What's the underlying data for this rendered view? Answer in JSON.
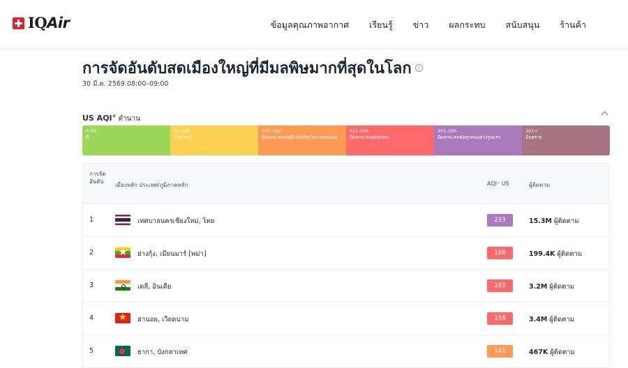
{
  "header": {
    "logo": {
      "prefix": "IQ",
      "suffix": "Air"
    },
    "nav": [
      {
        "label": "ข้อมูลคุณภาพอากาศ"
      },
      {
        "label": "เรียนรู้"
      },
      {
        "label": "ข่าว"
      },
      {
        "label": "ผลกระทบ"
      },
      {
        "label": "สนับสนุน"
      },
      {
        "label": "ร้านค้า"
      }
    ]
  },
  "page": {
    "title": "การจัดอันดับสดเมืองใหญ่ที่มีมลพิษมากที่สุดในโลก",
    "info_icon": "i",
    "timestamp": "30 มี.ค. 2569 08:00–09:00"
  },
  "legend": {
    "title": "US AQI",
    "title_sup": "+",
    "title_sub": "ตำนาน",
    "segments": [
      {
        "range": "0-50",
        "desc": "ดี",
        "color": "#9bd85a"
      },
      {
        "range": "51-100",
        "desc": "ปานกลาง",
        "color": "#fcd152"
      },
      {
        "range": "101-150",
        "desc": "มีผลกระทบต่อผู้ป่วยหรือร่างกายอ่อนแอ",
        "color": "#fd9b55"
      },
      {
        "range": "151-200",
        "desc": "มีผลกระทบต่อทุกคน",
        "color": "#fe6a69"
      },
      {
        "range": "201-300",
        "desc": "มีผลกระทบต่อทุกคนอย่างรุนแรง",
        "color": "#a97abc"
      },
      {
        "range": "301+",
        "desc": "อันตราย",
        "color": "#a87383"
      }
    ]
  },
  "table": {
    "headers": {
      "rank": "การจัดอันดับ",
      "city": "เมืองหลัก ประเทศ/ภูมิภาคหลัก",
      "aqi": "AQI⁺ US",
      "followers": "ผู้ติดตาม"
    },
    "rows": [
      {
        "rank": "1",
        "flag": "thailand-flag",
        "city": "เทศบาลนครเชียงใหม่, ไทย",
        "aqi": "233",
        "aqi_color": "#a97abc",
        "followers": "15.3M",
        "followers_label": "ผู้ติดตาม"
      },
      {
        "rank": "2",
        "flag": "myanmar-flag",
        "city": "ย่างกุ้ง, เมียนมาร์ [พม่า]",
        "aqi": "186",
        "aqi_color": "#fe6a69",
        "followers": "199.4K",
        "followers_label": "ผู้ติดตาม"
      },
      {
        "rank": "3",
        "flag": "india-flag",
        "city": "เดลี, อินเดีย",
        "aqi": "183",
        "aqi_color": "#fe6a69",
        "followers": "3.2M",
        "followers_label": "ผู้ติดตาม"
      },
      {
        "rank": "4",
        "flag": "vietnam-flag",
        "city": "ฮานอย, เวียดนาม",
        "aqi": "158",
        "aqi_color": "#fe6a69",
        "followers": "3.4M",
        "followers_label": "ผู้ติดตาม"
      },
      {
        "rank": "5",
        "flag": "bangladesh-flag",
        "city": "ธากา, บังกลาเทศ",
        "aqi": "141",
        "aqi_color": "#fd9b55",
        "followers": "467K",
        "followers_label": "ผู้ติดตาม"
      }
    ]
  }
}
